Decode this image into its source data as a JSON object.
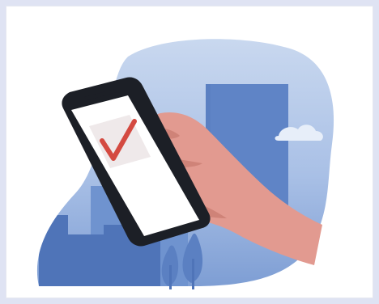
{
  "illustration": {
    "icon": "phone-checkmark-illustration",
    "colors": {
      "frame": "#dfe3f3",
      "card": "#ffffff",
      "blob_top": "#c9d8ef",
      "blob_bottom": "#7e9ed4",
      "building_dark": "#4f74b8",
      "building_mid": "#6f93cf",
      "tree": "#5b80c2",
      "hand": "#e29a90",
      "hand_shadow": "#cf8378",
      "phone_body": "#1c1f26",
      "screen": "#ffffff",
      "check_bg": "#efe9ea",
      "check": "#d44a41",
      "cloud": "#e7eef9"
    }
  }
}
